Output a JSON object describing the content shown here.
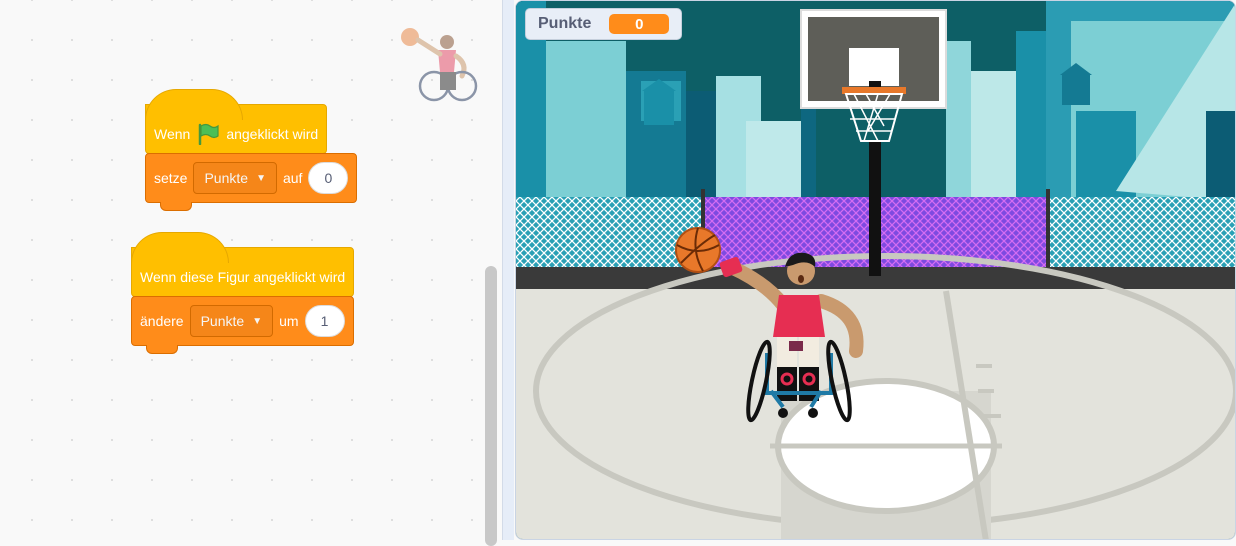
{
  "code": {
    "script1": {
      "hat_prefix": "Wenn",
      "hat_suffix": "angeklickt wird",
      "flag_icon": "green-flag-icon",
      "cmd_label": "setze",
      "variable": "Punkte",
      "cmd_mid": "auf",
      "value": "0"
    },
    "script2": {
      "hat_label": "Wenn diese Figur angeklickt wird",
      "cmd_label": "ändere",
      "variable": "Punkte",
      "cmd_mid": "um",
      "value": "1"
    },
    "sprite_thumbnail_icon": "wheelchair-player-icon"
  },
  "stage": {
    "monitor_label": "Punkte",
    "monitor_value": "0"
  },
  "colors": {
    "event_yellow": "#ffbf00",
    "variable_orange": "#ff8c1a"
  }
}
